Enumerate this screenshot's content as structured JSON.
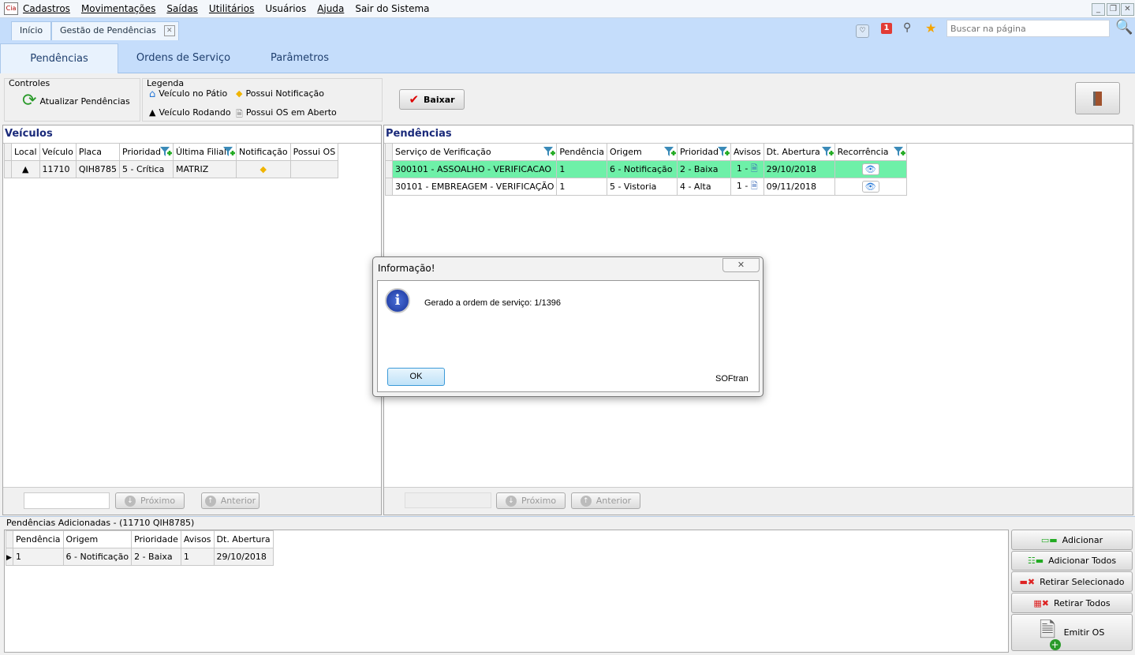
{
  "menu": [
    "Cadastros",
    "Movimentações",
    "Saídas",
    "Utilitários",
    "Usuários",
    "Ajuda",
    "Sair do Sistema"
  ],
  "doc_tabs": [
    "Início",
    "Gestão de Pendências"
  ],
  "search_placeholder": "Buscar na página",
  "notification_count": "1",
  "main_tabs": [
    "Pendências",
    "Ordens de Serviço",
    "Parâmetros"
  ],
  "controles": {
    "title": "Controles",
    "refresh": "Atualizar Pendências"
  },
  "legenda": {
    "title": "Legenda",
    "items": [
      "Veículo no Pátio",
      "Veículo Rodando",
      "Possui Notificação",
      "Possui OS em Aberto"
    ]
  },
  "baixar": "Baixar",
  "veiculos": {
    "title": "Veículos",
    "columns": [
      "Local",
      "Veículo",
      "Placa",
      "Prioridad",
      "Última Filial",
      "Notificação",
      "Possui OS"
    ],
    "rows": [
      [
        "",
        "11710",
        "QIH8785",
        "5 - Crítica",
        "MATRIZ",
        "",
        ""
      ]
    ]
  },
  "pendencias": {
    "title": "Pendências",
    "columns": [
      "Serviço de Verificação",
      "Pendência",
      "Origem",
      "Prioridad",
      "Avisos",
      "Dt. Abertura",
      "Recorrência"
    ],
    "rows": [
      [
        "300101 - ASSOALHO - VERIFICACAO",
        "1",
        "6 - Notificação",
        "2 - Baixa",
        "1 -",
        "29/10/2018",
        ""
      ],
      [
        "30101 - EMBREAGEM - VERIFICAÇÃO",
        "1",
        "5 - Vistoria",
        "4 - Alta",
        "1 -",
        "09/11/2018",
        ""
      ]
    ]
  },
  "nav": {
    "next": "Próximo",
    "prev": "Anterior"
  },
  "adicionadas": {
    "title": "Pendências Adicionadas - (11710 QIH8785)",
    "columns": [
      "Pendência",
      "Origem",
      "Prioridade",
      "Avisos",
      "Dt. Abertura"
    ],
    "rows": [
      [
        "1",
        "6 - Notificação",
        "2 - Baixa",
        "1",
        "29/10/2018"
      ]
    ]
  },
  "actions": [
    "Adicionar",
    "Adicionar Todos",
    "Retirar Selecionado",
    "Retirar Todos",
    "Emitir OS"
  ],
  "dialog": {
    "title": "Informação!",
    "message": "Gerado a ordem de serviço: 1/1396",
    "ok": "OK",
    "brand": "SOFtran"
  }
}
